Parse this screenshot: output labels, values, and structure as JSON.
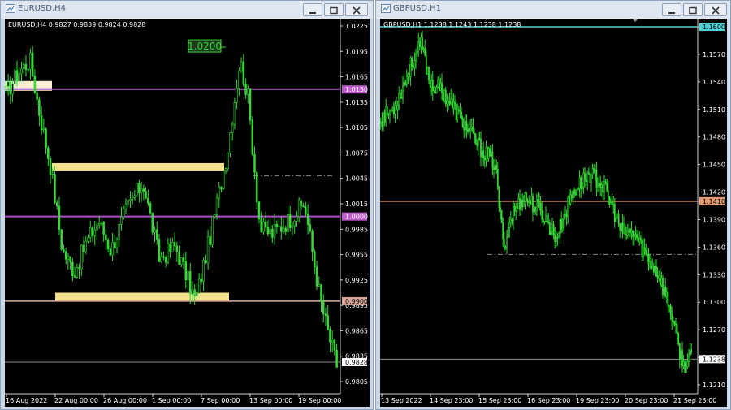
{
  "windows": [
    {
      "title": "EURUSD,H4",
      "symbol_line": "EURUSD,H4  0.9827 0.9839 0.9824 0.9828",
      "price_labels": [
        "1.0225",
        "1.0195",
        "1.0165",
        "1.0135",
        "1.0105",
        "1.0075",
        "1.0045",
        "1.0015",
        "0.9985",
        "0.9955",
        "0.9925",
        "0.9895",
        "0.9865",
        "0.9835",
        "0.9805"
      ],
      "date_labels": [
        "16 Aug 2022",
        "22 Aug 00:00",
        "26 Aug 00:00",
        "1 Sep 00:00",
        "7 Sep 00:00",
        "13 Sep 00:00",
        "19 Sep 00:00"
      ],
      "badges": [
        {
          "text": "1.0150",
          "bg": "#c05ccf",
          "fg": "#ffffff"
        },
        {
          "text": "1.0000",
          "bg": "#c05ccf",
          "fg": "#ffffff"
        },
        {
          "text": "0.9900",
          "bg": "#d7a79a",
          "fg": "#000000"
        },
        {
          "text": "0.9828",
          "bg": "#ffffff",
          "fg": "#000000"
        }
      ],
      "annotation": "1.0200",
      "colors": {
        "candles": "#36d936",
        "level_violet": "#b44ad0",
        "level_salmon": "#e0ad9e",
        "zone": "#f5e08e",
        "annotation": "#3ad23a",
        "current": "#8a8a8a"
      }
    },
    {
      "title": "GBPUSD,H1",
      "symbol_line": "GBPUSD,H1  1.1238 1.1243 1.1238 1.1238",
      "price_labels": [
        "1.1600",
        "1.1570",
        "1.1540",
        "1.1510",
        "1.1480",
        "1.1450",
        "1.1420",
        "1.1390",
        "1.1360",
        "1.1330",
        "1.1300",
        "1.1270",
        "1.1240",
        "1.1210"
      ],
      "date_labels": [
        "13 Sep 2022",
        "14 Sep 23:00",
        "15 Sep 23:00",
        "16 Sep 23:00",
        "19 Sep 23:00",
        "20 Sep 23:00",
        "21 Sep 23:00"
      ],
      "badges": [
        {
          "text": "1.1600",
          "bg": "#4fd5d6",
          "fg": "#000000"
        },
        {
          "text": "1.1410",
          "bg": "#e49a73",
          "fg": "#000000"
        },
        {
          "text": "1.1238",
          "bg": "#ffffff",
          "fg": "#000000"
        }
      ],
      "colors": {
        "candles": "#36d936",
        "level_cyan": "#4fd5d6",
        "level_orange": "#e49a73",
        "current": "#8a8a8a"
      }
    }
  ]
}
